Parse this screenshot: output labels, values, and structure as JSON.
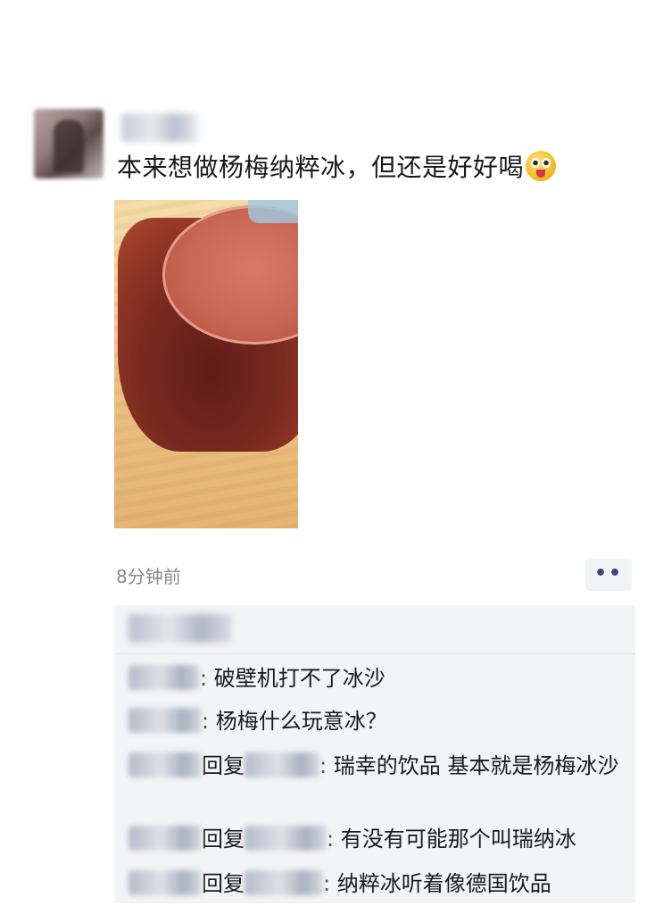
{
  "post": {
    "text": "本来想做杨梅纳粹冰，但还是好好喝",
    "emoji_icon": "astonished-face-icon",
    "time": "8分钟前",
    "more_label": "••"
  },
  "comments": [
    {
      "text": "破壁机打不了冰沙"
    },
    {
      "text": "杨梅什么玩意冰？"
    },
    {
      "reply_word": "回复",
      "text": "瑞幸的饮品 基本就是杨梅冰沙"
    },
    {
      "reply_word": "回复",
      "text": "有没有可能那个叫瑞纳冰"
    },
    {
      "reply_word": "回复",
      "text": "纳粹冰听着像德国饮品"
    }
  ],
  "colors": {
    "link": "#3a4a78",
    "time": "#8a8a8a",
    "comment_bg": "#f3f4f6"
  }
}
